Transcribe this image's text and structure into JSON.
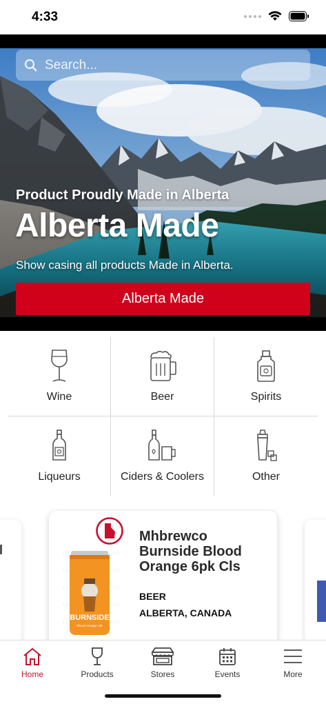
{
  "status_bar": {
    "time": "4:33",
    "icons": [
      "signal-icon",
      "wifi-icon",
      "battery-icon"
    ]
  },
  "search": {
    "placeholder": "Search...",
    "icon": "search-icon"
  },
  "hero": {
    "subtitle": "Product Proudly Made in Alberta",
    "title": "Alberta Made",
    "description": "Show casing all products Made in Alberta.",
    "button_label": "Alberta Made",
    "button_color": "#d0021b"
  },
  "categories": [
    {
      "label": "Wine",
      "icon": "wine-glass-icon"
    },
    {
      "label": "Beer",
      "icon": "beer-mug-icon"
    },
    {
      "label": "Spirits",
      "icon": "spirits-bottle-icon"
    },
    {
      "label": "Liqueurs",
      "icon": "liqueur-bottle-icon"
    },
    {
      "label": "Ciders & Coolers",
      "icon": "cider-bottle-glass-icon"
    },
    {
      "label": "Other",
      "icon": "shaker-icon"
    }
  ],
  "featured_product": {
    "badge": "alberta-made-badge-icon",
    "name_line1": "Mhbrewco",
    "name_line2": "Burnside Blood",
    "name_line3": "Orange 6pk Cls",
    "category": "BEER",
    "origin": "ALBERTA, CANADA",
    "can_text": "BURNSIDE",
    "can_subtext": "blood orange ale"
  },
  "tabs": [
    {
      "label": "Home",
      "icon": "home-icon",
      "active": true
    },
    {
      "label": "Products",
      "icon": "wine-glass-icon",
      "active": false
    },
    {
      "label": "Stores",
      "icon": "store-icon",
      "active": false
    },
    {
      "label": "Events",
      "icon": "calendar-icon",
      "active": false
    },
    {
      "label": "More",
      "icon": "menu-icon",
      "active": false
    }
  ],
  "colors": {
    "accent": "#d0021b",
    "active_tab": "#c8102e",
    "text": "#222222"
  }
}
